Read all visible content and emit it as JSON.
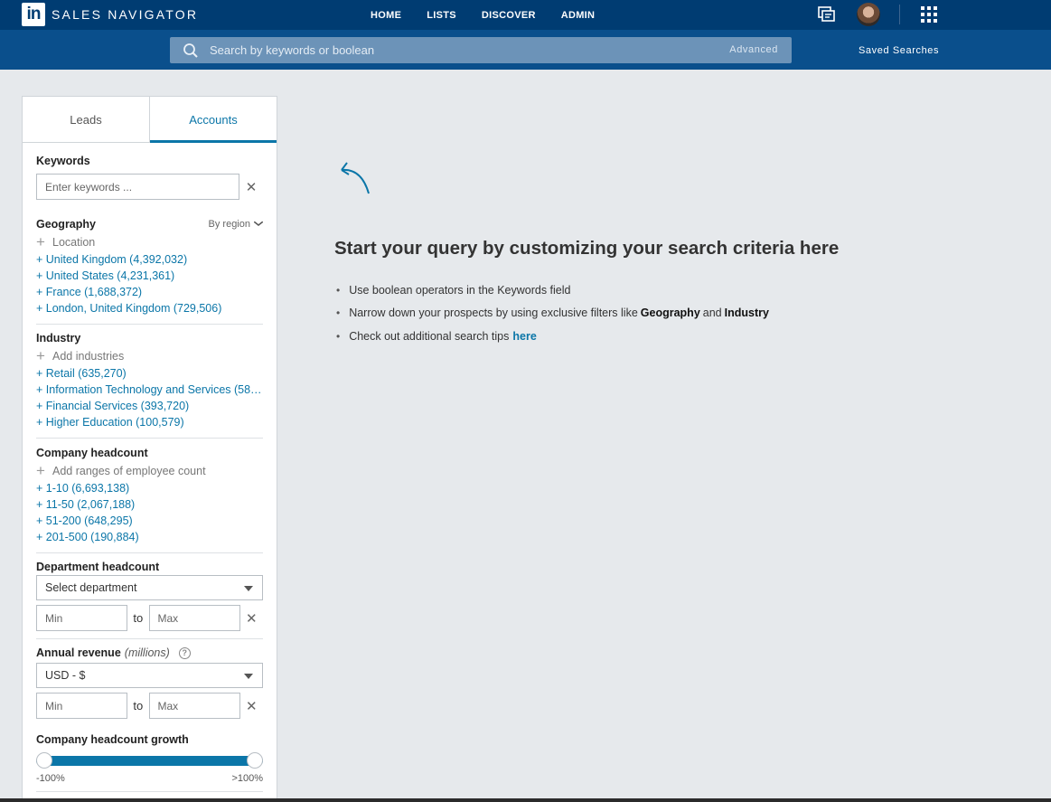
{
  "header": {
    "logo_text": "in",
    "brand": "SALES NAVIGATOR",
    "nav": [
      "HOME",
      "LISTS",
      "DISCOVER",
      "ADMIN"
    ]
  },
  "search": {
    "placeholder": "Search by keywords or boolean",
    "advanced_label": "Advanced",
    "saved_searches_label": "Saved Searches"
  },
  "tabs": {
    "leads": "Leads",
    "accounts": "Accounts",
    "active": "Accounts"
  },
  "filters": {
    "keywords": {
      "title": "Keywords",
      "placeholder": "Enter keywords ..."
    },
    "geography": {
      "title": "Geography",
      "mode": "By region",
      "add_label": "Location",
      "options": [
        "+ United Kingdom (4,392,032)",
        "+ United States (4,231,361)",
        "+ France (1,688,372)",
        "+ London, United Kingdom (729,506)"
      ]
    },
    "industry": {
      "title": "Industry",
      "add_label": "Add industries",
      "options": [
        "+ Retail (635,270)",
        "+ Information Technology and Services (58…",
        "+ Financial Services (393,720)",
        "+ Higher Education (100,579)"
      ]
    },
    "company_headcount": {
      "title": "Company headcount",
      "add_label": "Add ranges of employee count",
      "options": [
        "+ 1-10 (6,693,138)",
        "+ 11-50 (2,067,188)",
        "+ 51-200 (648,295)",
        "+ 201-500 (190,884)"
      ]
    },
    "department_headcount": {
      "title": "Department headcount",
      "select_value": "Select department",
      "min_placeholder": "Min",
      "max_placeholder": "Max",
      "to_label": "to"
    },
    "annual_revenue": {
      "title": "Annual revenue",
      "title_suffix": "(millions)",
      "help": "?",
      "select_value": "USD - $",
      "min_placeholder": "Min",
      "max_placeholder": "Max",
      "to_label": "to"
    },
    "headcount_growth": {
      "title": "Company headcount growth",
      "min_label": "-100%",
      "max_label": ">100%"
    }
  },
  "main": {
    "headline": "Start your query by customizing your search criteria here",
    "tip1": "Use boolean operators in the Keywords field",
    "tip2_pre": "Narrow down your prospects by using exclusive filters like",
    "tip2_b1": "Geography",
    "tip2_and": "and",
    "tip2_b2": "Industry",
    "tip3_pre": "Check out additional search tips",
    "tip3_link": "here"
  },
  "colors": {
    "nav_bg": "#003c72",
    "search_row_bg": "#0a4f8c",
    "accent": "#0b76a8",
    "page_bg": "#e6e9ec"
  }
}
